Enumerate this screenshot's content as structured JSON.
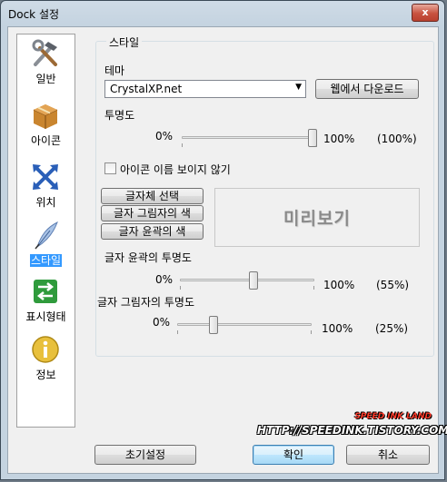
{
  "window": {
    "title": "Dock 설정",
    "close_label": "x"
  },
  "sidebar": {
    "items": [
      {
        "label": "일반",
        "icon": "hammer-wrench-icon"
      },
      {
        "label": "아이콘",
        "icon": "box-icon"
      },
      {
        "label": "위치",
        "icon": "arrows-icon"
      },
      {
        "label": "스타일",
        "icon": "feather-pen-icon",
        "active": true
      },
      {
        "label": "표시형태",
        "icon": "exchange-icon"
      },
      {
        "label": "정보",
        "icon": "info-icon"
      }
    ]
  },
  "style_group": {
    "title": "스타일",
    "theme_label": "테마",
    "theme_value": "CrystalXP.net",
    "download_button": "웹에서 다운로드",
    "opacity_label": "투명도",
    "opacity_min": "0%",
    "opacity_max": "100%",
    "opacity_value": "(100%)",
    "opacity_level": 1.0,
    "hide_names_label": "아이콘 이름 보이지 않기",
    "hide_names_checked": false,
    "font_button": "글자체 선택",
    "shadow_color_button": "글자 그림자의 색",
    "outline_color_button": "글자 윤곽의 색",
    "preview_text": "미리보기",
    "outline_opacity_label": "글자 윤곽의 투명도",
    "outline_min": "0%",
    "outline_max": "100%",
    "outline_value": "(55%)",
    "outline_level": 0.55,
    "shadow_opacity_label": "글자 그림자의 투명도",
    "shadow_min": "0%",
    "shadow_max": "100%",
    "shadow_value": "(25%)",
    "shadow_level": 0.25
  },
  "footer": {
    "reset_button": "초기설정",
    "ok_button": "확인",
    "cancel_button": "취소"
  },
  "watermark": {
    "line1": "SPEED INK LAND",
    "line2": "HTTP://SPEEDINK.TISTORY.COM/"
  }
}
